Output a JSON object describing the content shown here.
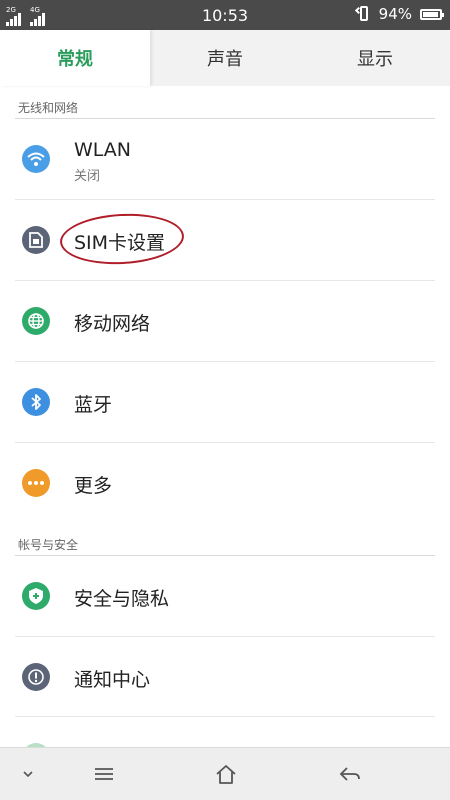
{
  "status_bar": {
    "sim1_tag": "2G",
    "sim2_tag": "4G",
    "time": "10:53",
    "battery_percent": "94%",
    "battery_level": 0.94
  },
  "tabs": [
    {
      "label": "常规",
      "active": true
    },
    {
      "label": "声音",
      "active": false
    },
    {
      "label": "显示",
      "active": false
    }
  ],
  "sections": [
    {
      "header": "无线和网络",
      "items": [
        {
          "title": "WLAN",
          "subtitle": "关闭",
          "icon": "wifi-icon",
          "color": "#4a9ee6"
        },
        {
          "title": "SIM卡设置",
          "subtitle": "",
          "icon": "sim-card-icon",
          "color": "#5b6577"
        },
        {
          "title": "移动网络",
          "subtitle": "",
          "icon": "globe-icon",
          "color": "#2eaa6a"
        },
        {
          "title": "蓝牙",
          "subtitle": "",
          "icon": "bluetooth-icon",
          "color": "#3d8fe0"
        },
        {
          "title": "更多",
          "subtitle": "",
          "icon": "more-dots-icon",
          "color": "#f09a2a"
        }
      ]
    },
    {
      "header": "帐号与安全",
      "items": [
        {
          "title": "安全与隐私",
          "subtitle": "",
          "icon": "shield-plus-icon",
          "color": "#2eaa6a"
        },
        {
          "title": "通知中心",
          "subtitle": "",
          "icon": "exclamation-icon",
          "color": "#5b6577"
        }
      ]
    }
  ],
  "colors": {
    "accent": "#2a9d5c",
    "annotation": "#b01e2a"
  }
}
